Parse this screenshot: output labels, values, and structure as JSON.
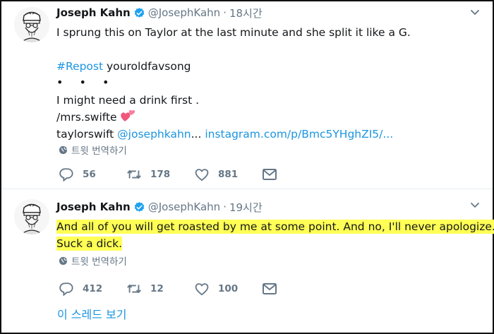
{
  "tweets": [
    {
      "name": "Joseph Kahn",
      "handle": "@JosephKahn",
      "time": "18시간",
      "lines": {
        "l1": "I sprung this on Taylor at the last minute and she split it like a G.",
        "repost_tag": "#Repost",
        "repost_user": " youroldfavsong",
        "dots": "• • •",
        "drink": "I might need a drink first .",
        "mrs": "/mrs.swifte",
        "ts_user": "taylorswift ",
        "ts_mention": "@josephkahn",
        "ellipsis": "... ",
        "link": "instagram.com/p/Bmc5YHghZI5/..."
      },
      "translate": "트윗 번역하기",
      "reply_count": "56",
      "retweet_count": "178",
      "like_count": "881"
    },
    {
      "name": "Joseph Kahn",
      "handle": "@JosephKahn",
      "time": "19시간",
      "lines": {
        "l1": "And all of you will get roasted by me at some point. And no, I'll never apologize.",
        "l2": "Suck a dick."
      },
      "translate": "트윗 번역하기",
      "reply_count": "412",
      "retweet_count": "12",
      "like_count": "100"
    }
  ],
  "thread_link": "이 스레드 보기",
  "colors": {
    "accent": "#1b95e0",
    "muted": "#657786",
    "highlight": "#ffff55",
    "heart_pink": "#f1567a"
  },
  "icons": [
    "avatar-sketch",
    "verified-badge",
    "caret-down",
    "globe",
    "reply",
    "retweet",
    "like",
    "message",
    "two-hearts"
  ]
}
